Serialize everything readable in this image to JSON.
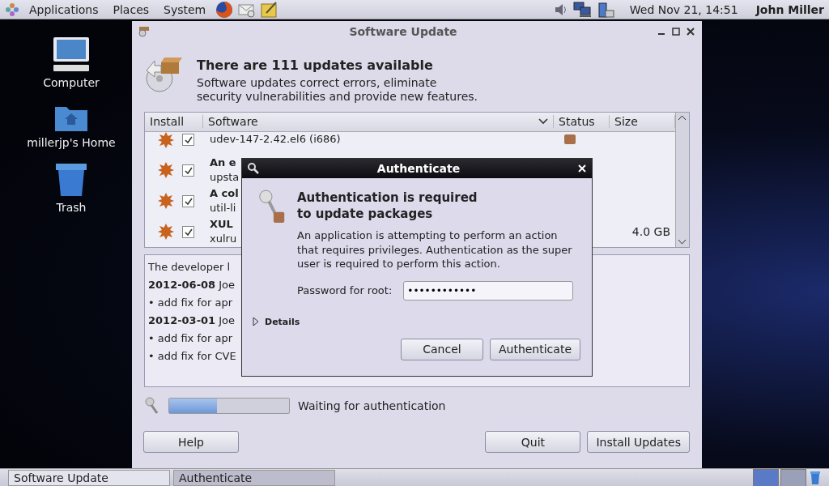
{
  "top_panel": {
    "menus": [
      "Applications",
      "Places",
      "System"
    ],
    "clock": "Wed Nov 21, 14:51",
    "user": "John Miller"
  },
  "desktop_icons": [
    {
      "label": "Computer",
      "kind": "computer"
    },
    {
      "label": "millerjp's Home",
      "kind": "home"
    },
    {
      "label": "Trash",
      "kind": "trash"
    }
  ],
  "window": {
    "title": "Software Update",
    "heading": "There are 111 updates available",
    "description": "Software updates correct errors, eliminate security vulnerabilities and provide new features.",
    "table": {
      "columns": [
        "Install",
        "Software",
        "Status",
        "Size"
      ],
      "rows": [
        {
          "checked": true,
          "package": "udev-147-2.42.el6 (i686)",
          "status_icon": true
        },
        {
          "checked": true,
          "summary": "An e",
          "package": "upsta"
        },
        {
          "checked": true,
          "summary": "A col",
          "package": "util-li"
        },
        {
          "checked": true,
          "summary": "XUL",
          "package": "xulru",
          "size": "4.0 GB"
        }
      ]
    },
    "changelog": [
      "The developer l",
      "**2012-06-08** Joe",
      "• add fix for apr",
      "**2012-03-01** Joe",
      "• add fix for apr",
      "• add fix for CVE"
    ],
    "progress": {
      "level": 0.4,
      "status": "Waiting for authentication"
    },
    "buttons": [
      "Help",
      "Quit",
      "Install Updates"
    ]
  },
  "dialog": {
    "title": "Authenticate",
    "heading": "Authentication is required to update packages",
    "message": "An application is attempting to perform an action that requires privileges. Authentication as the super user is required to perform this action.",
    "password_label": "Password for root:",
    "password_value": "••••••••••••",
    "details": {
      "label": "Details",
      "expanded": false
    },
    "buttons": [
      "Cancel",
      "Authenticate"
    ]
  },
  "taskbar": [
    {
      "label": "Software Update",
      "selected": false
    },
    {
      "label": "Authenticate",
      "selected": true
    }
  ]
}
